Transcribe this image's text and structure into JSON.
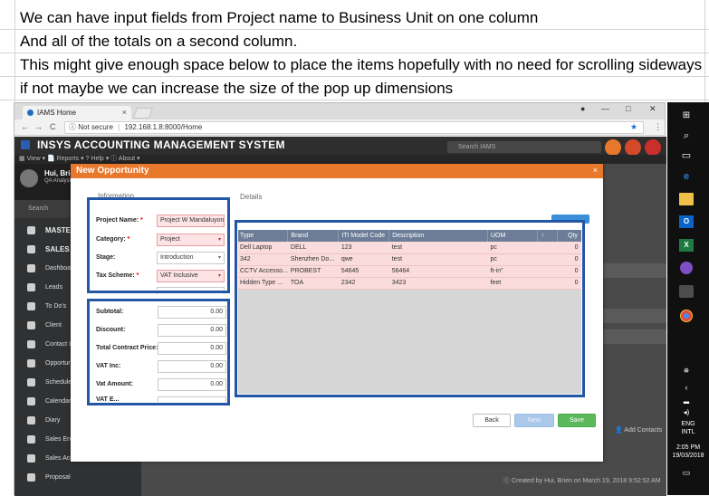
{
  "notes": [
    "We can have input fields from Project name to Business Unit on one column",
    "And all of the totals on a second column.",
    "This might give enough space below to place the items hopefully with no need for scrolling sideways",
    "if not maybe we can increase the size of the pop up dimensions"
  ],
  "browser": {
    "tab_title": "IAMS Home",
    "tab_close": "×",
    "url_secure": "Not secure",
    "url": "192.168.1.8:8000/Home",
    "win_min": "—",
    "win_max": "□",
    "win_close": "✕",
    "back": "←",
    "forward": "→",
    "reload": "C",
    "info": "ⓘ"
  },
  "app": {
    "title": "INSYS ACCOUNTING MANAGEMENT SYSTEM",
    "subheader": "▦ View ▾   📄 Reports ▾   ? Help ▾   ⓘ About ▾",
    "search_placeholder": "Search IAMS",
    "user_name": "Hui, Brien",
    "user_role": "QA Analyst",
    "sidebar_search": "Search",
    "sidebar": [
      {
        "label": "MASTER FILE",
        "section": true
      },
      {
        "label": "SALES PIPELINE",
        "section": true
      },
      {
        "label": "Dashboard",
        "section": false
      },
      {
        "label": "Leads",
        "section": false
      },
      {
        "label": "To Do's",
        "section": false
      },
      {
        "label": "Client",
        "section": false
      },
      {
        "label": "Contact List",
        "section": false
      },
      {
        "label": "Opportunities",
        "section": false
      },
      {
        "label": "Schedule (Ca",
        "section": false
      },
      {
        "label": "Calendar (List",
        "section": false
      },
      {
        "label": "Diary",
        "section": false
      },
      {
        "label": "Sales Endorsement",
        "section": false
      },
      {
        "label": "Sales Account",
        "section": false
      },
      {
        "label": "Proposal",
        "section": false
      }
    ],
    "add_contacts": "👤 Add Contacts",
    "created_by": "ⓒ Created by Hui, Brien on March 19, 2018 9:52:52 AM"
  },
  "modal": {
    "title": "New Opportunity",
    "close": "×",
    "info_section": "Information",
    "details_section": "Details",
    "fields": [
      {
        "label": "Project Name:",
        "required": true,
        "value": "Project W Mandaluyong",
        "dropdown": false
      },
      {
        "label": "Category:",
        "required": true,
        "value": "Project",
        "dropdown": true
      },
      {
        "label": "Stage:",
        "required": false,
        "value": "Introduction",
        "dropdown": true
      },
      {
        "label": "Tax Scheme:",
        "required": true,
        "value": "VAT Inclusive",
        "dropdown": true
      }
    ],
    "totals": [
      {
        "label": "Subtotal:",
        "value": "0.00"
      },
      {
        "label": "Discount:",
        "value": "0.00"
      },
      {
        "label": "Total Contract Price:",
        "value": "0.00"
      },
      {
        "label": "VAT Inc:",
        "value": "0.00"
      },
      {
        "label": "Vat Amount:",
        "value": "0.00"
      },
      {
        "label": "VAT E...",
        "value": ""
      }
    ],
    "columns": [
      "Type",
      "Brand",
      "ITI Model Code",
      "Description",
      "UOM",
      "↑",
      "Qty"
    ],
    "rows": [
      [
        "Dell Laptop",
        "DELL",
        "123",
        "test",
        "pc",
        "",
        "0"
      ],
      [
        "342",
        "Shenzhen Do...",
        "qwe",
        "test",
        "pc",
        "",
        "0"
      ],
      [
        "CCTV Accesso...",
        "PROBEST",
        "54645",
        "56464",
        "ft-in\"",
        "",
        "0"
      ],
      [
        "Hidden Type ...",
        "TOA",
        "2342",
        "3423",
        "feet",
        "",
        "0"
      ]
    ],
    "back_label": "Back",
    "next_label": "Next",
    "save_label": "Save"
  },
  "taskbar": {
    "lang_line1": "ENG",
    "lang_line2": "INTL",
    "time": "2:05 PM",
    "date": "19/03/2018"
  },
  "colors": {
    "modal_header": "#e8782c",
    "annotation_frame": "#2456a6",
    "table_header": "#6d7d97",
    "row_pink": "#fbdcdc",
    "save_button": "#5cb85c"
  }
}
